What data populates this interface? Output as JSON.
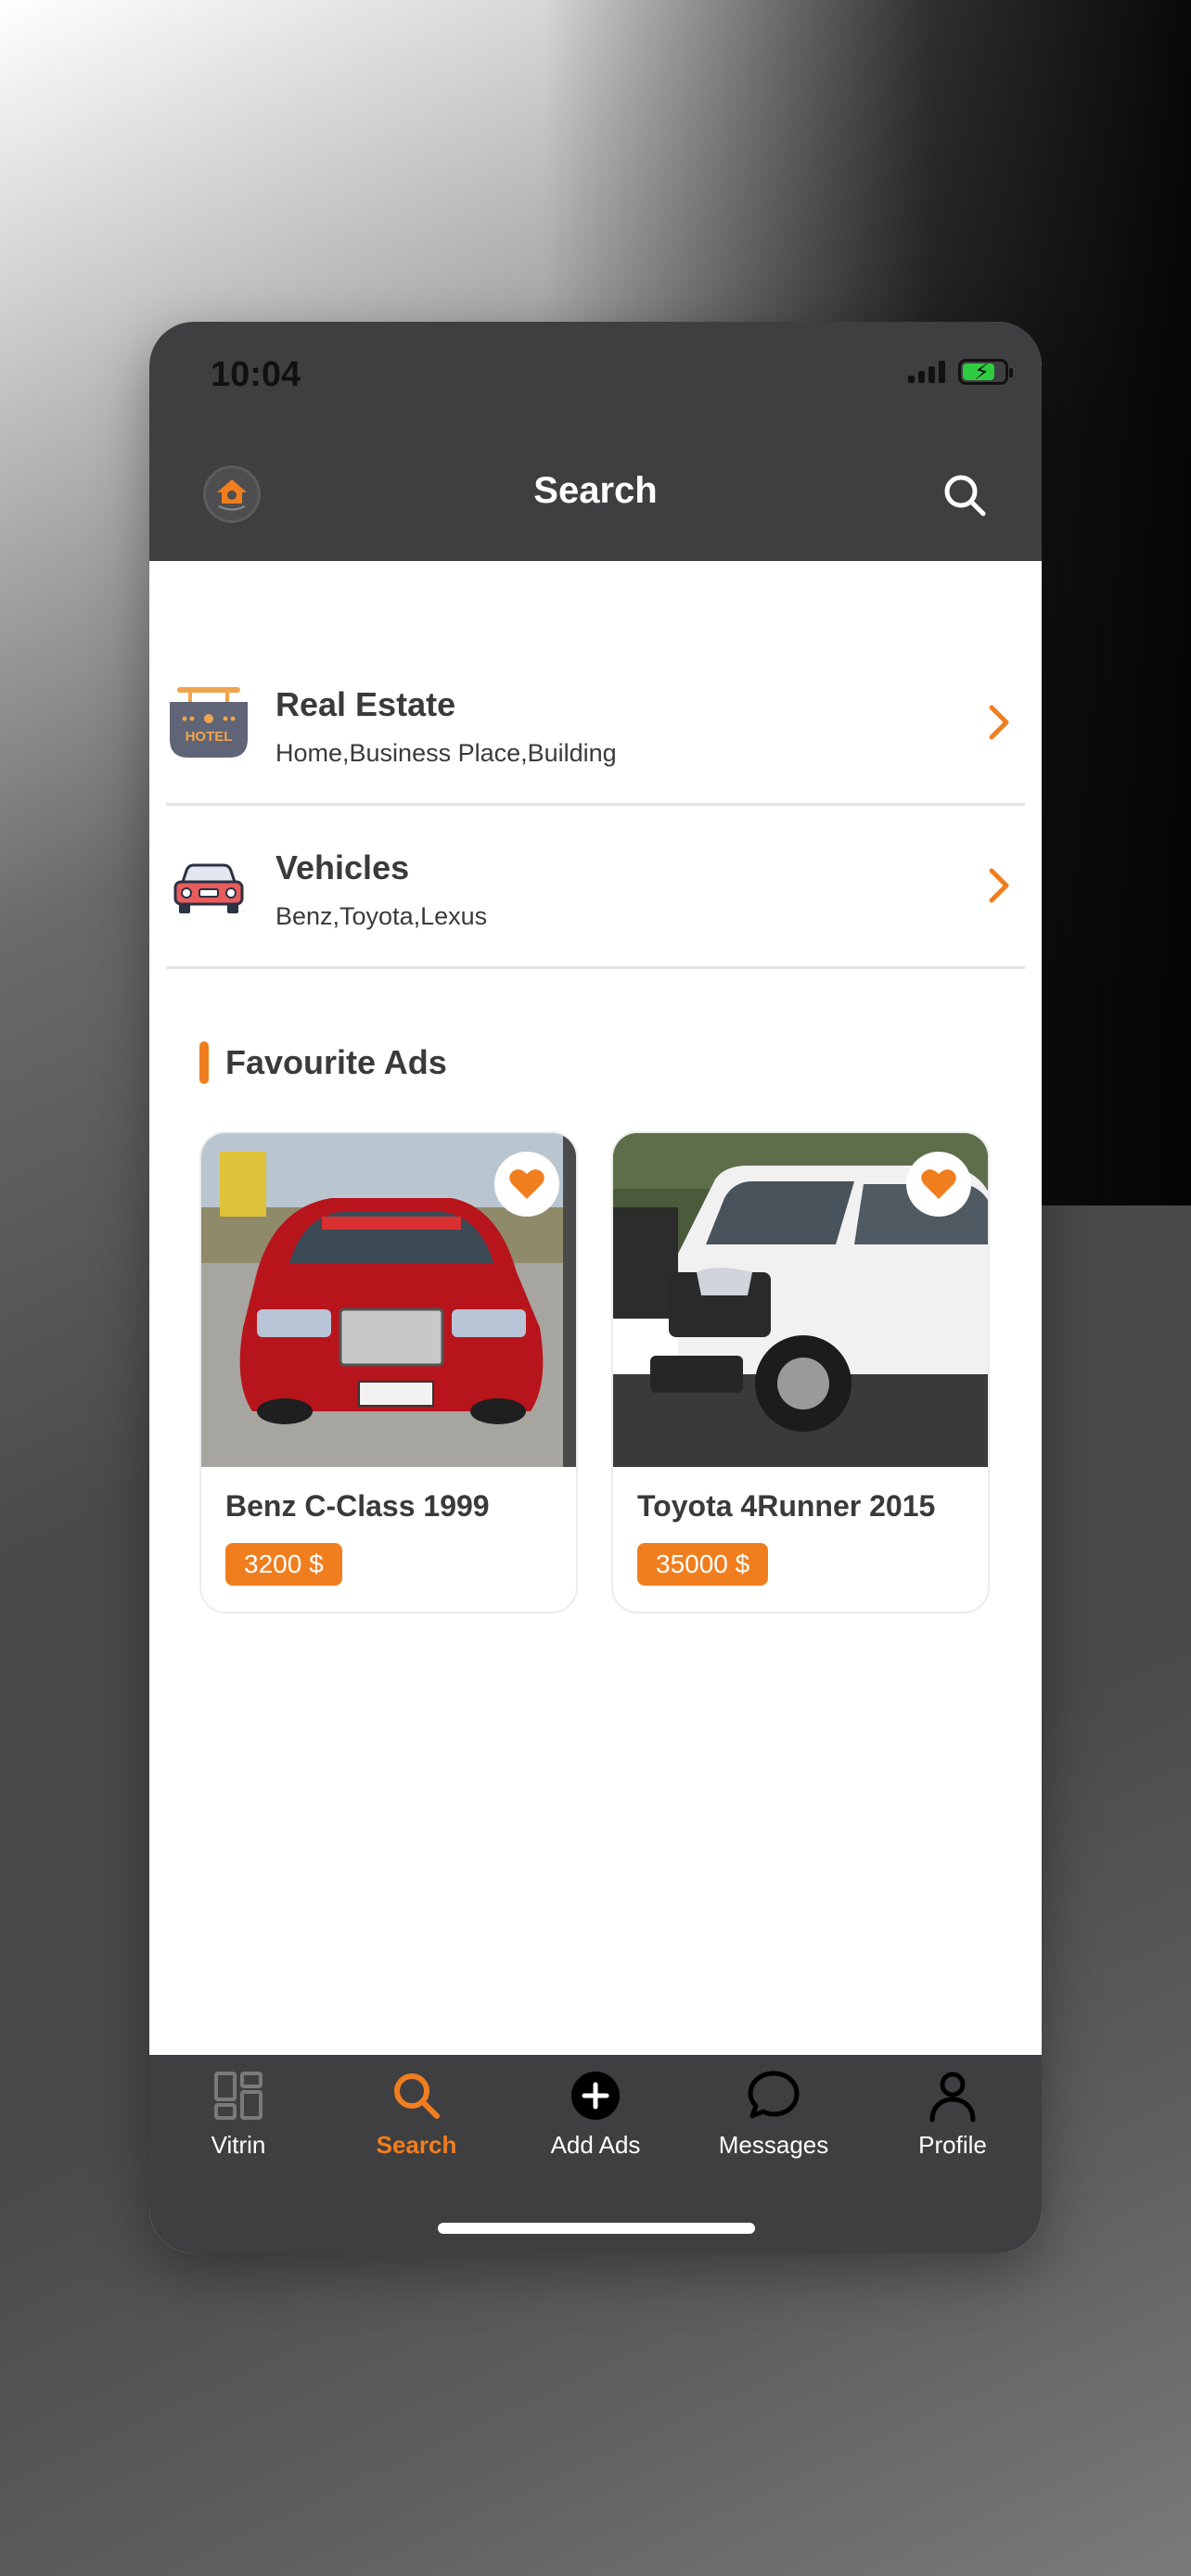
{
  "status": {
    "time": "10:04"
  },
  "header": {
    "title": "Search"
  },
  "categories": [
    {
      "title": "Real Estate",
      "subtitle": "Home,Business Place,Building",
      "icon": "hotel-icon",
      "icon_text": "HOTEL"
    },
    {
      "title": "Vehicles",
      "subtitle": "Benz,Toyota,Lexus",
      "icon": "car-icon"
    }
  ],
  "favourites": {
    "title": "Favourite Ads",
    "items": [
      {
        "title": "Benz C-Class 1999",
        "price": "3200 $",
        "image": "red-mercedes-photo",
        "favorited": true
      },
      {
        "title": "Toyota 4Runner 2015",
        "price": "35000 $",
        "image": "white-toyota-photo",
        "favorited": true
      }
    ]
  },
  "tabs": [
    {
      "label": "Vitrin",
      "icon": "grid-icon",
      "active": false
    },
    {
      "label": "Search",
      "icon": "search-icon",
      "active": true
    },
    {
      "label": "Add Ads",
      "icon": "add-circle-icon",
      "active": false
    },
    {
      "label": "Messages",
      "icon": "chat-bubble-icon",
      "active": false
    },
    {
      "label": "Profile",
      "icon": "person-icon",
      "active": false
    }
  ],
  "colors": {
    "accent": "#f07e1e",
    "bar": "#3f3f41",
    "text": "#3a3a3a"
  }
}
